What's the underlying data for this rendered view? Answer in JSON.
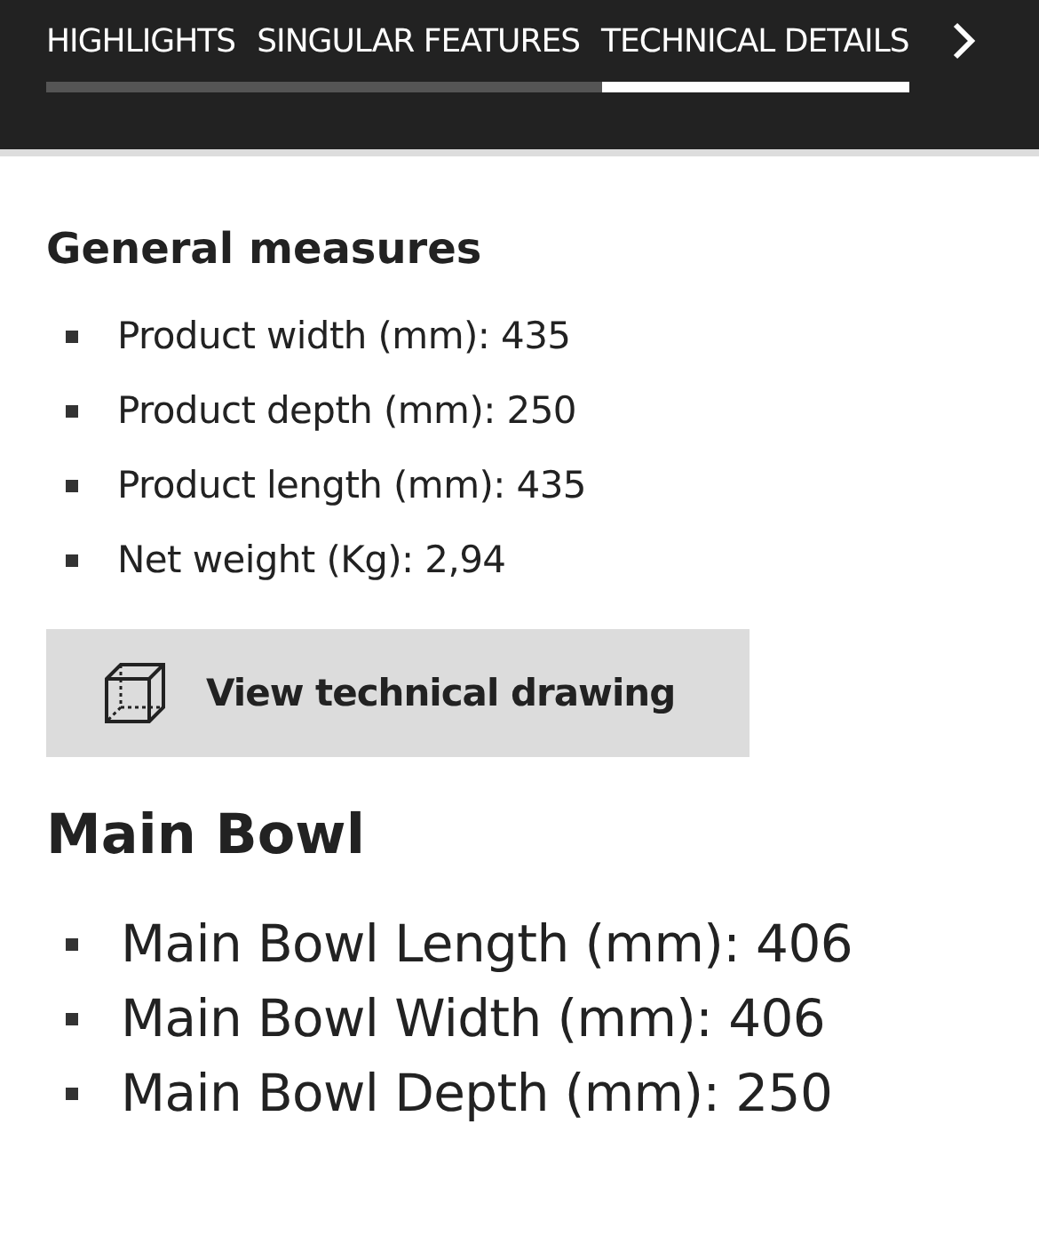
{
  "tabs": [
    {
      "label": "HIGHLIGHTS",
      "selected": false
    },
    {
      "label": "SINGULAR FEATURES",
      "selected": false
    },
    {
      "label": "TECHNICAL DETAILS",
      "selected": true
    }
  ],
  "blocks": [
    {
      "kind": "section",
      "title": "General measures",
      "items": [
        "Product width (mm): 435",
        "Product depth (mm): 250",
        "Product length (mm): 435",
        "Net weight (Kg): 2,94"
      ]
    },
    {
      "kind": "button",
      "label": "View technical drawing"
    },
    {
      "kind": "bigsection",
      "title": "Main Bowl",
      "items": [
        "Main Bowl Length (mm): 406",
        "Main Bowl Width (mm): 406",
        "Main Bowl Depth (mm): 250"
      ]
    }
  ]
}
